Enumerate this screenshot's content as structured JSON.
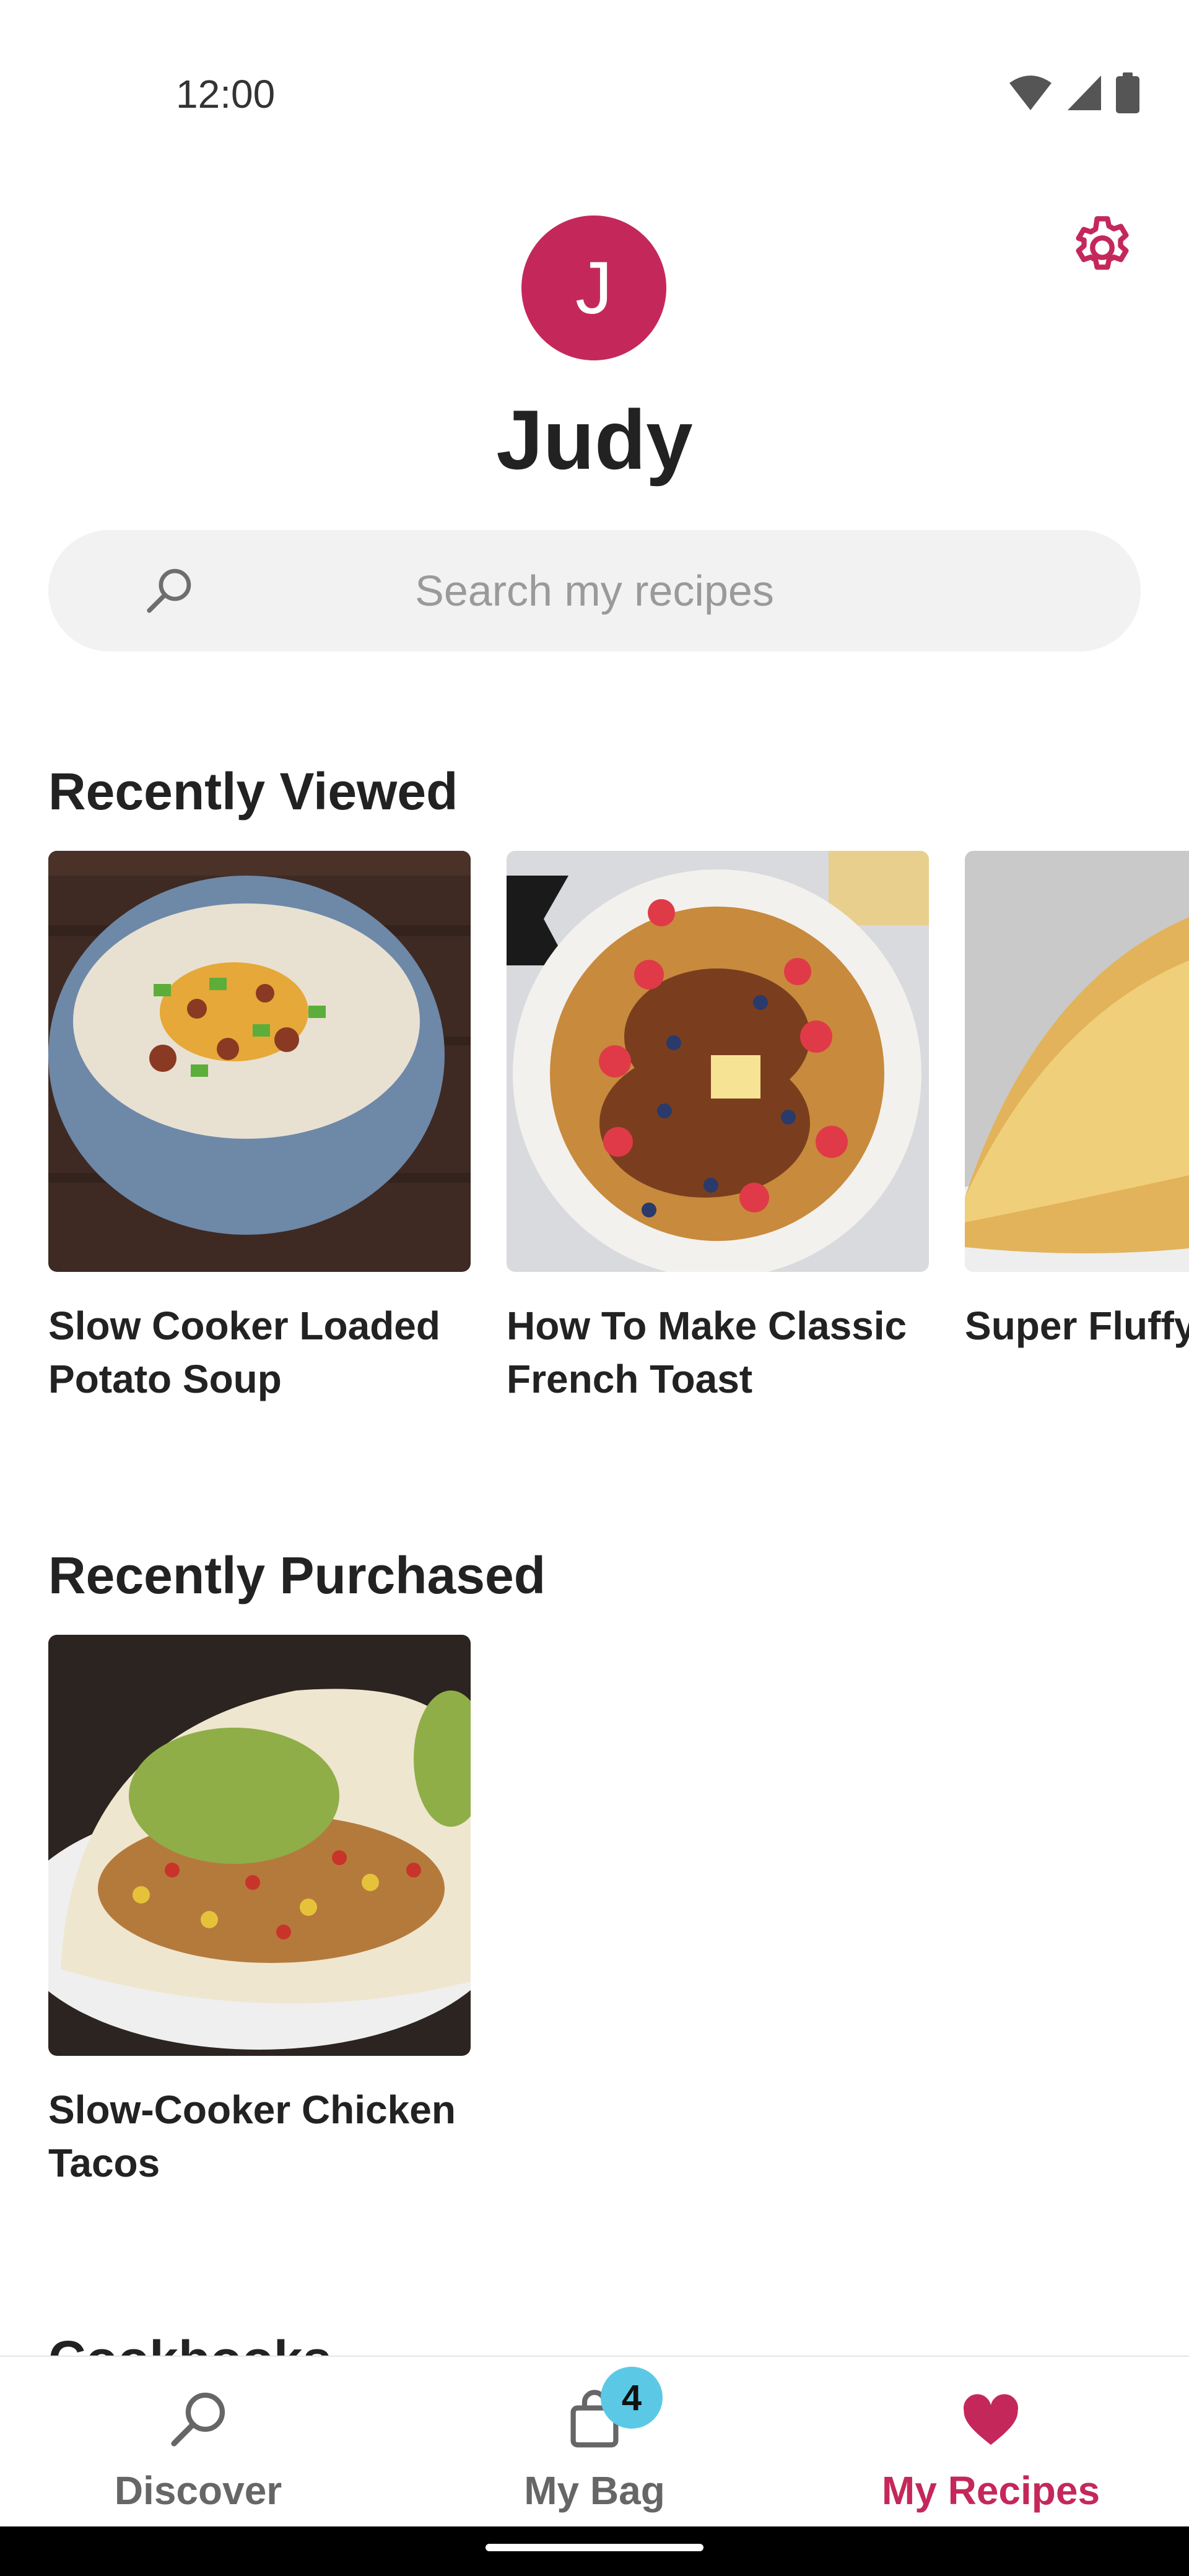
{
  "status_bar": {
    "time": "12:00",
    "icons": [
      "wifi-icon",
      "cellular-signal-icon",
      "battery-icon"
    ]
  },
  "header": {
    "avatar_initial": "J",
    "name": "Judy",
    "settings_icon": "gear-icon"
  },
  "search": {
    "placeholder": "Search my recipes",
    "value": ""
  },
  "sections": {
    "recently_viewed": {
      "title": "Recently Viewed",
      "items": [
        {
          "title": "Slow Cooker Loaded\nPotato Soup"
        },
        {
          "title": "How To Make Classic\nFrench Toast"
        },
        {
          "title": "Super Fluffy"
        }
      ]
    },
    "recently_purchased": {
      "title": "Recently Purchased",
      "items": [
        {
          "title": "Slow-Cooker Chicken\nTacos"
        }
      ]
    },
    "cookbooks": {
      "title": "Cookbooks"
    }
  },
  "bottom_nav": {
    "discover": "Discover",
    "my_bag": "My Bag",
    "bag_count": "4",
    "my_recipes": "My Recipes"
  },
  "colors": {
    "accent": "#c4285b",
    "badge": "#5bc9e6",
    "search_bg": "#f2f2f2"
  }
}
